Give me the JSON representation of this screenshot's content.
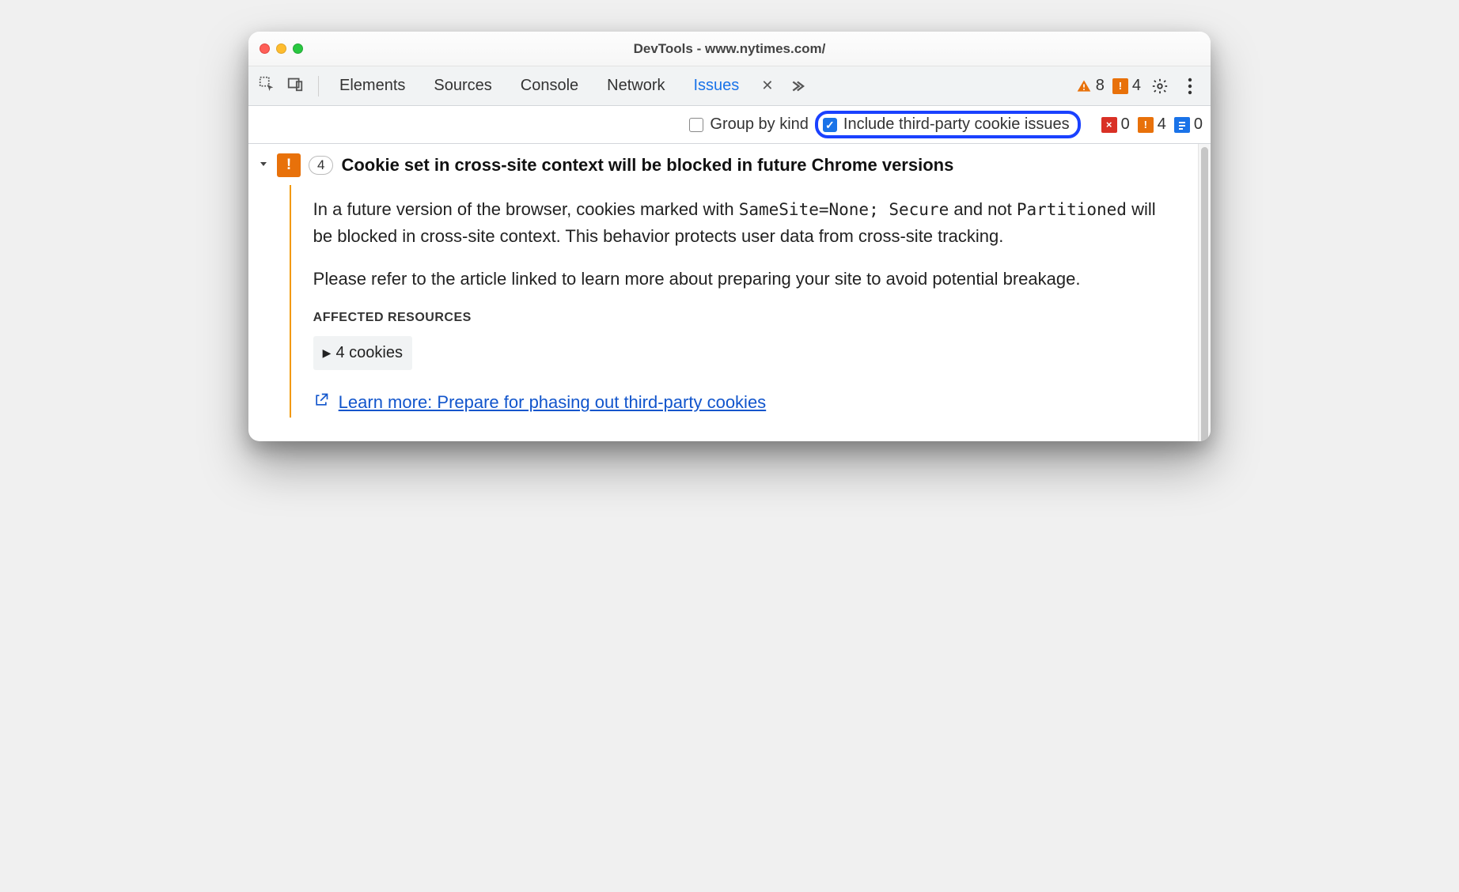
{
  "window": {
    "title": "DevTools - www.nytimes.com/"
  },
  "tabs": {
    "items": [
      "Elements",
      "Sources",
      "Console",
      "Network",
      "Issues"
    ],
    "active": "Issues"
  },
  "tabStats": {
    "triangle_count": "8",
    "square_count": "4"
  },
  "filterBar": {
    "groupByKind": {
      "label": "Group by kind",
      "checked": false
    },
    "includeThirdParty": {
      "label": "Include third-party cookie issues",
      "checked": true
    },
    "counts": {
      "red": "0",
      "orange": "4",
      "blue": "0"
    }
  },
  "issue": {
    "count": "4",
    "title": "Cookie set in cross-site context will be blocked in future Chrome versions",
    "para1_pre": "In a future version of the browser, cookies marked with ",
    "para1_code1": "SameSite=None; Secure",
    "para1_mid": " and not ",
    "para1_code2": "Partitioned",
    "para1_post": " will be blocked in cross-site context. This behavior protects user data from cross-site tracking.",
    "para2": "Please refer to the article linked to learn more about preparing your site to avoid potential breakage.",
    "affected_label": "AFFECTED RESOURCES",
    "resource_text": "4 cookies",
    "learn_more": "Learn more: Prepare for phasing out third-party cookies"
  }
}
